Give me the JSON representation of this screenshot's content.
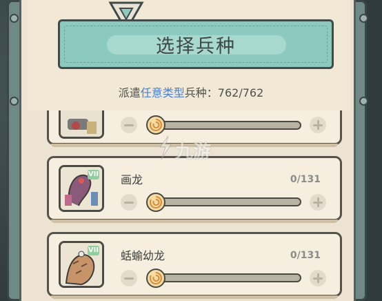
{
  "header": {
    "title": "选择兵种",
    "dispatch_prefix": "派遣",
    "dispatch_highlight": "任意类型",
    "dispatch_suffix": "兵种：",
    "dispatch_count": "762/762"
  },
  "units": [
    {
      "name": "",
      "count": "",
      "rank": "",
      "slider_fraction": 0
    },
    {
      "name": "画龙",
      "count": "0/131",
      "rank": "VII",
      "slider_fraction": 0
    },
    {
      "name": "蛞蝓幼龙",
      "count": "0/131",
      "rank": "VII",
      "slider_fraction": 0
    }
  ],
  "watermark": {
    "text": "九游"
  },
  "colors": {
    "accent_teal": "#8cc9bf",
    "highlight_blue": "#4b7fcf",
    "panel": "#f6efdf",
    "rank_badge": "#8fcf9c"
  }
}
